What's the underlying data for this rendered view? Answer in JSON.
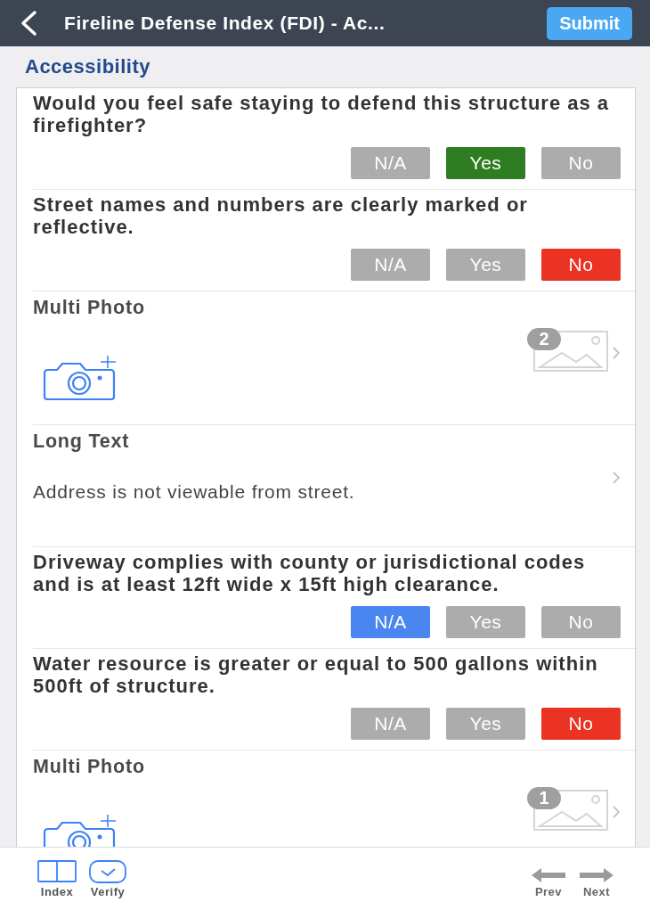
{
  "header": {
    "title": "Fireline Defense Index (FDI) - Ac...",
    "submit": "Submit"
  },
  "section": "Accessibility",
  "items": [
    {
      "kind": "question",
      "text": "Would you feel safe staying to defend this structure as a firefighter?",
      "options": [
        {
          "label": "N/A",
          "selected": false
        },
        {
          "label": "Yes",
          "selected": true
        },
        {
          "label": "No",
          "selected": false
        }
      ]
    },
    {
      "kind": "question",
      "text": "Street names and numbers are clearly marked or reflective.",
      "options": [
        {
          "label": "N/A",
          "selected": false
        },
        {
          "label": "Yes",
          "selected": false
        },
        {
          "label": "No",
          "selected": true
        }
      ]
    },
    {
      "kind": "multi_photo",
      "title": "Multi Photo",
      "count": "2"
    },
    {
      "kind": "long_text",
      "title": "Long Text",
      "value": "Address is not viewable from street."
    },
    {
      "kind": "question",
      "text": "Driveway complies with county or jurisdictional codes and is at least 12ft wide x 15ft high clearance.",
      "options": [
        {
          "label": "N/A",
          "selected": true
        },
        {
          "label": "Yes",
          "selected": false
        },
        {
          "label": "No",
          "selected": false
        }
      ]
    },
    {
      "kind": "question",
      "text": "Water resource is greater or equal to 500 gallons within 500ft of structure.",
      "options": [
        {
          "label": "N/A",
          "selected": false
        },
        {
          "label": "Yes",
          "selected": false
        },
        {
          "label": "No",
          "selected": true
        }
      ]
    },
    {
      "kind": "multi_photo",
      "title": "Multi Photo",
      "count": "1"
    }
  ],
  "footer": {
    "index": "Index",
    "verify": "Verify",
    "prev": "Prev",
    "next": "Next"
  }
}
